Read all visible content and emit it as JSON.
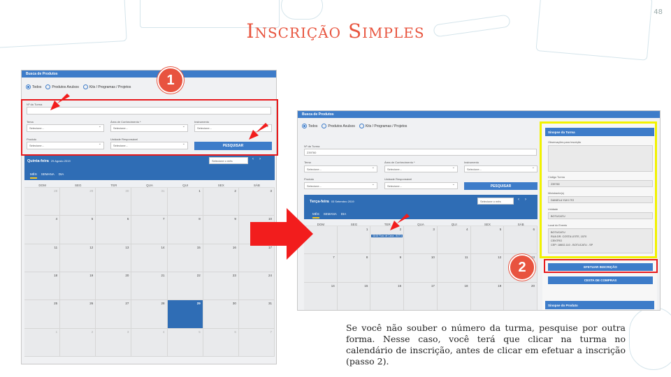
{
  "slide": {
    "title": "Inscrição Simples",
    "page_number": "48",
    "caption": "Se você não souber o número da turma, pesquise por outra forma. Nesse caso, você terá que clicar na turma no calendário de inscrição, antes de clicar em efetuar a inscrição (passo 2).",
    "step1": "1",
    "step2": "2",
    "accent_color": "#e8533f",
    "highlight_red": "#e8191c",
    "highlight_yellow": "#f2f200"
  },
  "search": {
    "header": "Busca de Produtos",
    "radio_all": "Todos",
    "radio_products": "Produtos Avulsos",
    "radio_kits": "Kits / Programas / Projetos",
    "class_no_label": "Nº da Turma",
    "class_no_value": "239760",
    "theme_label": "Tema",
    "area_label": "Área de Conhecimento *",
    "instrument_label": "Instrumento",
    "product_label": "Produto",
    "unit_label": "Unidade Responsável",
    "select_placeholder": "Selecione...",
    "search_button": "PESQUISAR"
  },
  "calendar_a": {
    "date_title": "Quinta-feira",
    "date_sub": "29 Agosto 2019",
    "month_select": "Selecione o mês",
    "tabs": [
      "MÊS",
      "SEMANA",
      "DIA"
    ],
    "days": [
      "DOM",
      "SEG",
      "TER",
      "QUA",
      "QUI",
      "SEX",
      "SÁB"
    ],
    "cells": [
      "28",
      "29",
      "30",
      "31",
      "1",
      "2",
      "3",
      "4",
      "5",
      "6",
      "7",
      "8",
      "9",
      "10",
      "11",
      "12",
      "13",
      "14",
      "15",
      "16",
      "17",
      "18",
      "19",
      "20",
      "21",
      "22",
      "23",
      "24",
      "25",
      "26",
      "27",
      "28",
      "29",
      "30",
      "31",
      "1",
      "2",
      "3",
      "4",
      "5",
      "6",
      "7"
    ],
    "muted_idx": [
      0,
      1,
      2,
      3,
      35,
      36,
      37,
      38,
      39,
      40,
      41
    ],
    "today_idx": 32
  },
  "calendar_b": {
    "date_title": "Terça-feira",
    "date_sub": "03 Setembro 2019",
    "month_select": "Selecione o mês",
    "tabs": [
      "MÊS",
      "SEMANA",
      "DIA"
    ],
    "days": [
      "DOM",
      "SEG",
      "TER",
      "QUA",
      "QUI",
      "SEX",
      "SÁB"
    ],
    "cells": [
      "",
      "2",
      "3",
      "4",
      "5",
      "6",
      "7",
      "8",
      "9",
      "10",
      "11",
      "12",
      "13",
      "14",
      "15",
      "16",
      "17",
      "18",
      "19",
      "20",
      "21"
    ],
    "cell_first": "1",
    "event_text": "08:00 Fluxo de Caixa - BOTU",
    "event_idx": 2
  },
  "summary": {
    "header": "Sinopse da Turma",
    "obs_label": "Observações para Inscrição",
    "code_label": "Código Turma",
    "code_value": "239760",
    "instructor_label": "Ministrante(s)",
    "instructor_value": "DANIELA YUKI ITO",
    "unit_label": "Unidade",
    "unit_value": "BOTUCATU",
    "location_label": "Local do Evento",
    "location_lines": [
      "BOTUCATU",
      "RUA DR. COSTA LEITE, 1570",
      "CENTRO",
      "CEP: 18602-110 - BOTUCATU - SP"
    ],
    "enroll_button": "EFETUAR INSCRIÇÃO",
    "cart_button": "CESTA DE COMPRAS",
    "product_header": "Sinopse do Produto"
  }
}
